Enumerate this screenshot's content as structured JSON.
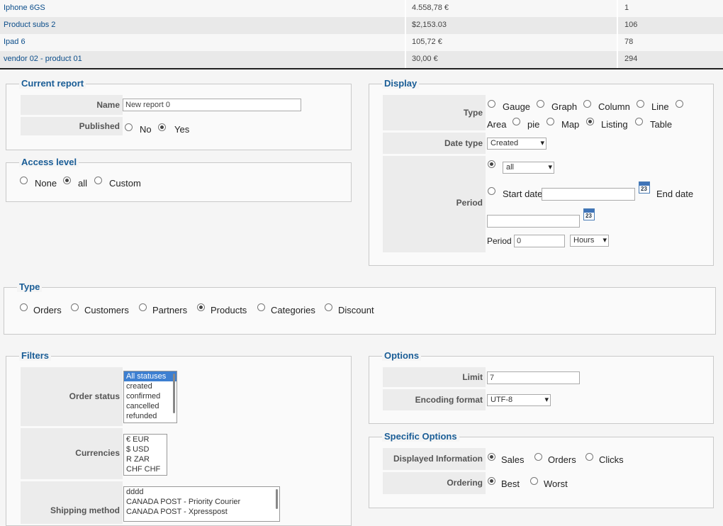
{
  "table": {
    "rows": [
      {
        "product": "Iphone 6GS",
        "amount": "4.558,78 €",
        "count": "1"
      },
      {
        "product": "Product subs 2",
        "amount": "$2,153.03",
        "count": "106"
      },
      {
        "product": "Ipad 6",
        "amount": "105,72 €",
        "count": "78"
      },
      {
        "product": "vendor 02 - product 01",
        "amount": "30,00 €",
        "count": "294"
      }
    ]
  },
  "current_report": {
    "legend": "Current report",
    "name_label": "Name",
    "name_value": "New report 0",
    "published_label": "Published",
    "no": "No",
    "yes": "Yes"
  },
  "access_level": {
    "legend": "Access level",
    "none": "None",
    "all": "all",
    "custom": "Custom"
  },
  "display": {
    "legend": "Display",
    "type_label": "Type",
    "types": [
      "Gauge",
      "Graph",
      "Column",
      "Line",
      "Area",
      "pie",
      "Map",
      "Listing",
      "Table"
    ],
    "date_type_label": "Date type",
    "date_type_value": "Created",
    "period_label": "Period",
    "period_select": "all",
    "start_date": "Start date",
    "end_date": "End date",
    "calendar_day": "23",
    "period_inline_label": "Period",
    "period_value": "0",
    "period_unit": "Hours"
  },
  "type_section": {
    "legend": "Type",
    "options": [
      "Orders",
      "Customers",
      "Partners",
      "Products",
      "Categories",
      "Discount"
    ]
  },
  "filters": {
    "legend": "Filters",
    "order_status_label": "Order status",
    "order_statuses": [
      "All statuses",
      "created",
      "confirmed",
      "cancelled",
      "refunded"
    ],
    "currencies_label": "Currencies",
    "currencies": [
      "€ EUR",
      "$ USD",
      "R ZAR",
      "CHF CHF"
    ],
    "shipping_label": "Shipping method",
    "shipping": [
      "dddd",
      "CANADA POST - Priority Courier",
      "CANADA POST - Xpresspost"
    ]
  },
  "options": {
    "legend": "Options",
    "limit_label": "Limit",
    "limit_value": "7",
    "encoding_label": "Encoding format",
    "encoding_value": "UTF-8"
  },
  "specific": {
    "legend": "Specific Options",
    "displayed_label": "Displayed Information",
    "displayed": [
      "Sales",
      "Orders",
      "Clicks"
    ],
    "ordering_label": "Ordering",
    "ordering": [
      "Best",
      "Worst"
    ]
  }
}
